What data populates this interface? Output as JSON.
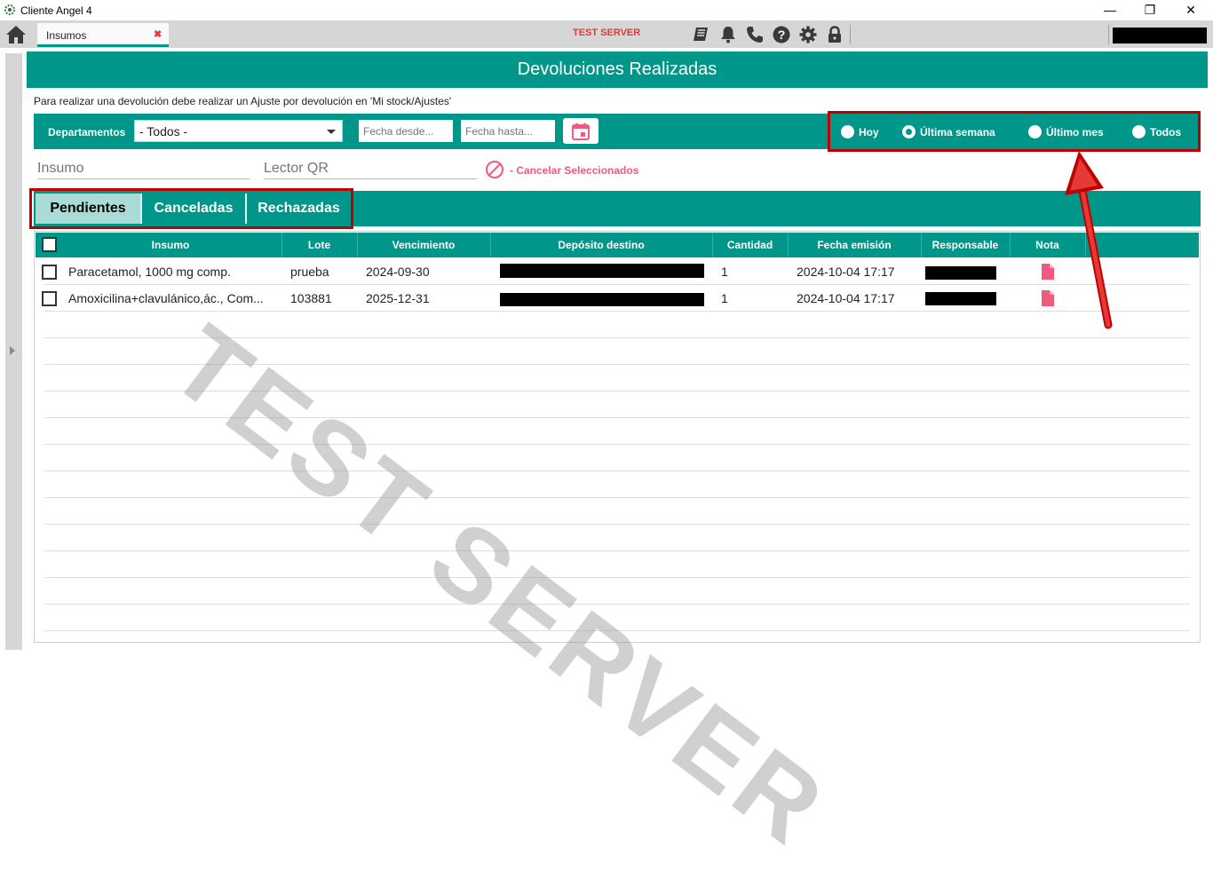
{
  "window": {
    "title": "Cliente Angel 4",
    "minimize": "—",
    "restore": "❐",
    "close": "✕"
  },
  "topbar": {
    "tab_label": "Insumos",
    "tab_close": "✖",
    "server_label": "TEST SERVER",
    "icons": [
      "manual-icon",
      "bell-icon",
      "phone-icon",
      "help-icon",
      "gear-icon",
      "lock-icon"
    ]
  },
  "page": {
    "title": "Devoluciones Realizadas",
    "info": "Para realizar una devolución debe realizar un Ajuste por devolución en 'Mi stock/Ajustes'",
    "watermark": "TEST SERVER"
  },
  "filters": {
    "departamentos_label": "Departamentos",
    "departamento_value": "- Todos -",
    "fecha_desde_placeholder": "Fecha desde...",
    "fecha_hasta_placeholder": "Fecha hasta...",
    "periodos": [
      {
        "label": "Hoy",
        "selected": false
      },
      {
        "label": "Última semana",
        "selected": true
      },
      {
        "label": "Último mes",
        "selected": false
      },
      {
        "label": "Todos",
        "selected": false
      }
    ]
  },
  "search": {
    "insumo_placeholder": "Insumo",
    "lector_placeholder": "Lector QR",
    "cancel_label": "- Cancelar Seleccionados"
  },
  "status_tabs": [
    {
      "label": "Pendientes",
      "active": true
    },
    {
      "label": "Canceladas",
      "active": false
    },
    {
      "label": "Rechazadas",
      "active": false
    }
  ],
  "table": {
    "headers": [
      "Insumo",
      "Lote",
      "Vencimiento",
      "Depósito destino",
      "Cantidad",
      "Fecha emisión",
      "Responsable",
      "Nota"
    ],
    "rows": [
      {
        "insumo": "Paracetamol, 1000 mg comp.",
        "lote": "prueba",
        "vencimiento": "2024-09-30",
        "cantidad": "1",
        "fecha_emision": "2024-10-04 17:17"
      },
      {
        "insumo": "Amoxicilina+clavulánico,ác., Com...",
        "lote": "103881",
        "vencimiento": "2025-12-31",
        "cantidad": "1",
        "fecha_emision": "2024-10-04 17:17"
      }
    ]
  },
  "colors": {
    "accent": "#00968a",
    "highlight": "#c00000",
    "danger": "#e53935",
    "note": "#f05a7e"
  }
}
